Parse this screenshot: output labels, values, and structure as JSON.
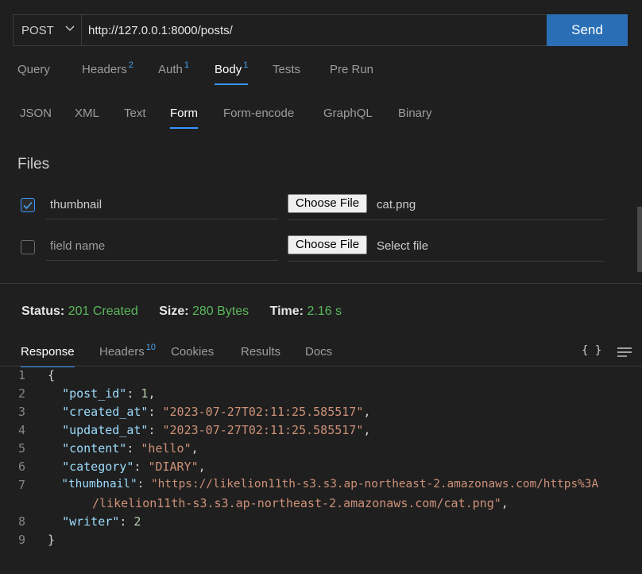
{
  "request": {
    "method": "POST",
    "url": "http://127.0.0.1:8000/posts/",
    "send_label": "Send"
  },
  "request_tabs": [
    {
      "label": "Query",
      "badge": ""
    },
    {
      "label": "Headers",
      "badge": "2"
    },
    {
      "label": "Auth",
      "badge": "1"
    },
    {
      "label": "Body",
      "badge": "1",
      "active": true
    },
    {
      "label": "Tests",
      "badge": ""
    },
    {
      "label": "Pre Run",
      "badge": ""
    }
  ],
  "body_tabs": [
    "JSON",
    "XML",
    "Text",
    "Form",
    "Form-encode",
    "GraphQL",
    "Binary"
  ],
  "body_active": "Form",
  "files": {
    "title": "Files",
    "rows": [
      {
        "checked": true,
        "field": "thumbnail",
        "button": "Choose File",
        "file": "cat.png"
      },
      {
        "checked": false,
        "field": "field name",
        "button": "Choose File",
        "file": "Select file"
      }
    ]
  },
  "status": {
    "status_label": "Status:",
    "status_value": "201 Created",
    "size_label": "Size:",
    "size_value": "280 Bytes",
    "time_label": "Time:",
    "time_value": "2.16 s"
  },
  "response_tabs": [
    {
      "label": "Response",
      "badge": "",
      "active": true
    },
    {
      "label": "Headers",
      "badge": "10"
    },
    {
      "label": "Cookies",
      "badge": ""
    },
    {
      "label": "Results",
      "badge": ""
    },
    {
      "label": "Docs",
      "badge": ""
    }
  ],
  "response_icons": {
    "braces": "{ }",
    "menu": "menu-lines-icon"
  },
  "response_code": {
    "line_numbers": [
      "1",
      "2",
      "3",
      "4",
      "5",
      "6",
      "7",
      "",
      "8",
      "9"
    ],
    "open_brace": "{",
    "close_brace": "}",
    "post_id_key": "\"post_id\"",
    "post_id_val": "1",
    "created_at_key": "\"created_at\"",
    "created_at_val": "\"2023-07-27T02:11:25.585517\"",
    "updated_at_key": "\"updated_at\"",
    "updated_at_val": "\"2023-07-27T02:11:25.585517\"",
    "content_key": "\"content\"",
    "content_val": "\"hello\"",
    "category_key": "\"category\"",
    "category_val": "\"DIARY\"",
    "thumbnail_key": "\"thumbnail\"",
    "thumbnail_val_1": "\"https://likelion11th-s3.s3.ap-northeast-2.amazonaws.com/https%3A",
    "thumbnail_val_2": "/likelion11th-s3.s3.ap-northeast-2.amazonaws.com/cat.png\"",
    "writer_key": "\"writer\"",
    "writer_val": "2"
  },
  "colors": {
    "accent": "#3794ff",
    "send": "#2a6fb5",
    "status_ok": "#5cb85c"
  }
}
